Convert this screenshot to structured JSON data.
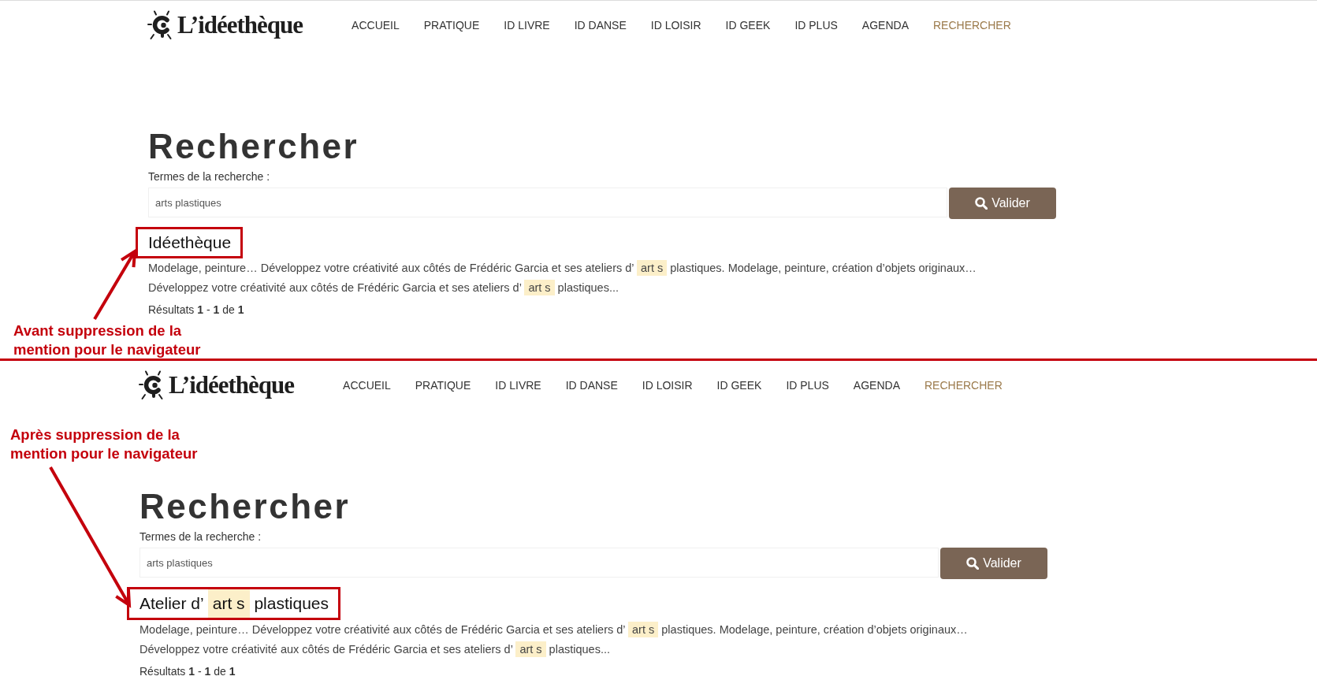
{
  "panels": [
    {
      "header": {
        "logo": "L’idéethèque",
        "nav": [
          {
            "label": "ACCUEIL",
            "selected": false
          },
          {
            "label": "PRATIQUE",
            "selected": false
          },
          {
            "label": "ID LIVRE",
            "selected": false
          },
          {
            "label": "ID DANSE",
            "selected": false
          },
          {
            "label": "ID LOISIR",
            "selected": false
          },
          {
            "label": "ID GEEK",
            "selected": false
          },
          {
            "label": "ID PLUS",
            "selected": false
          },
          {
            "label": "AGENDA",
            "selected": false
          },
          {
            "label": "RECHERCHER",
            "selected": true
          }
        ]
      },
      "search": {
        "heading": "Rechercher",
        "label": "Termes de la recherche :",
        "value": "arts plastiques",
        "button": "Valider"
      },
      "result": {
        "title": {
          "before": "Idéethèque"
        },
        "snippets": [
          {
            "before": "Modelage, peinture… Développez votre créativité aux côtés de Frédéric Garcia et ses ateliers d’",
            "match": "art s",
            "after": "plastiques. Modelage, peinture, création d’objets originaux…"
          },
          {
            "before": "Développez votre créativité aux côtés de Frédéric Garcia et ses ateliers d’",
            "match": "art s",
            "after": "plastiques..."
          }
        ],
        "summary": "Résultats **1** - **1** de **1**"
      },
      "annotation": {
        "text": "Avant suppression de la mention pour le navigateur"
      }
    },
    {
      "header": {
        "logo": "L’idéethèque",
        "nav": [
          {
            "label": "ACCUEIL",
            "selected": false
          },
          {
            "label": "PRATIQUE",
            "selected": false
          },
          {
            "label": "ID LIVRE",
            "selected": false
          },
          {
            "label": "ID DANSE",
            "selected": false
          },
          {
            "label": "ID LOISIR",
            "selected": false
          },
          {
            "label": "ID GEEK",
            "selected": false
          },
          {
            "label": "ID PLUS",
            "selected": false
          },
          {
            "label": "AGENDA",
            "selected": false
          },
          {
            "label": "RECHERCHER",
            "selected": true
          }
        ]
      },
      "annotation": {
        "text": "Après suppression de la mention pour le navigateur"
      },
      "search": {
        "heading": "Rechercher",
        "label": "Termes de la recherche :",
        "value": "arts plastiques",
        "button": "Valider"
      },
      "result": {
        "title": {
          "before": "Atelier d’",
          "match": "art s",
          "after": "plastiques"
        },
        "snippets": [
          {
            "before": "Modelage, peinture… Développez votre créativité aux côtés de Frédéric Garcia et ses ateliers d’",
            "match": "art s",
            "after": "plastiques. Modelage, peinture, création d’objets originaux…"
          },
          {
            "before": "Développez votre créativité aux côtés de Frédéric Garcia et ses ateliers d’",
            "match": "art s",
            "after": "plastiques..."
          }
        ],
        "summary": "Résultats **1** - **1** de **1**"
      }
    }
  ]
}
